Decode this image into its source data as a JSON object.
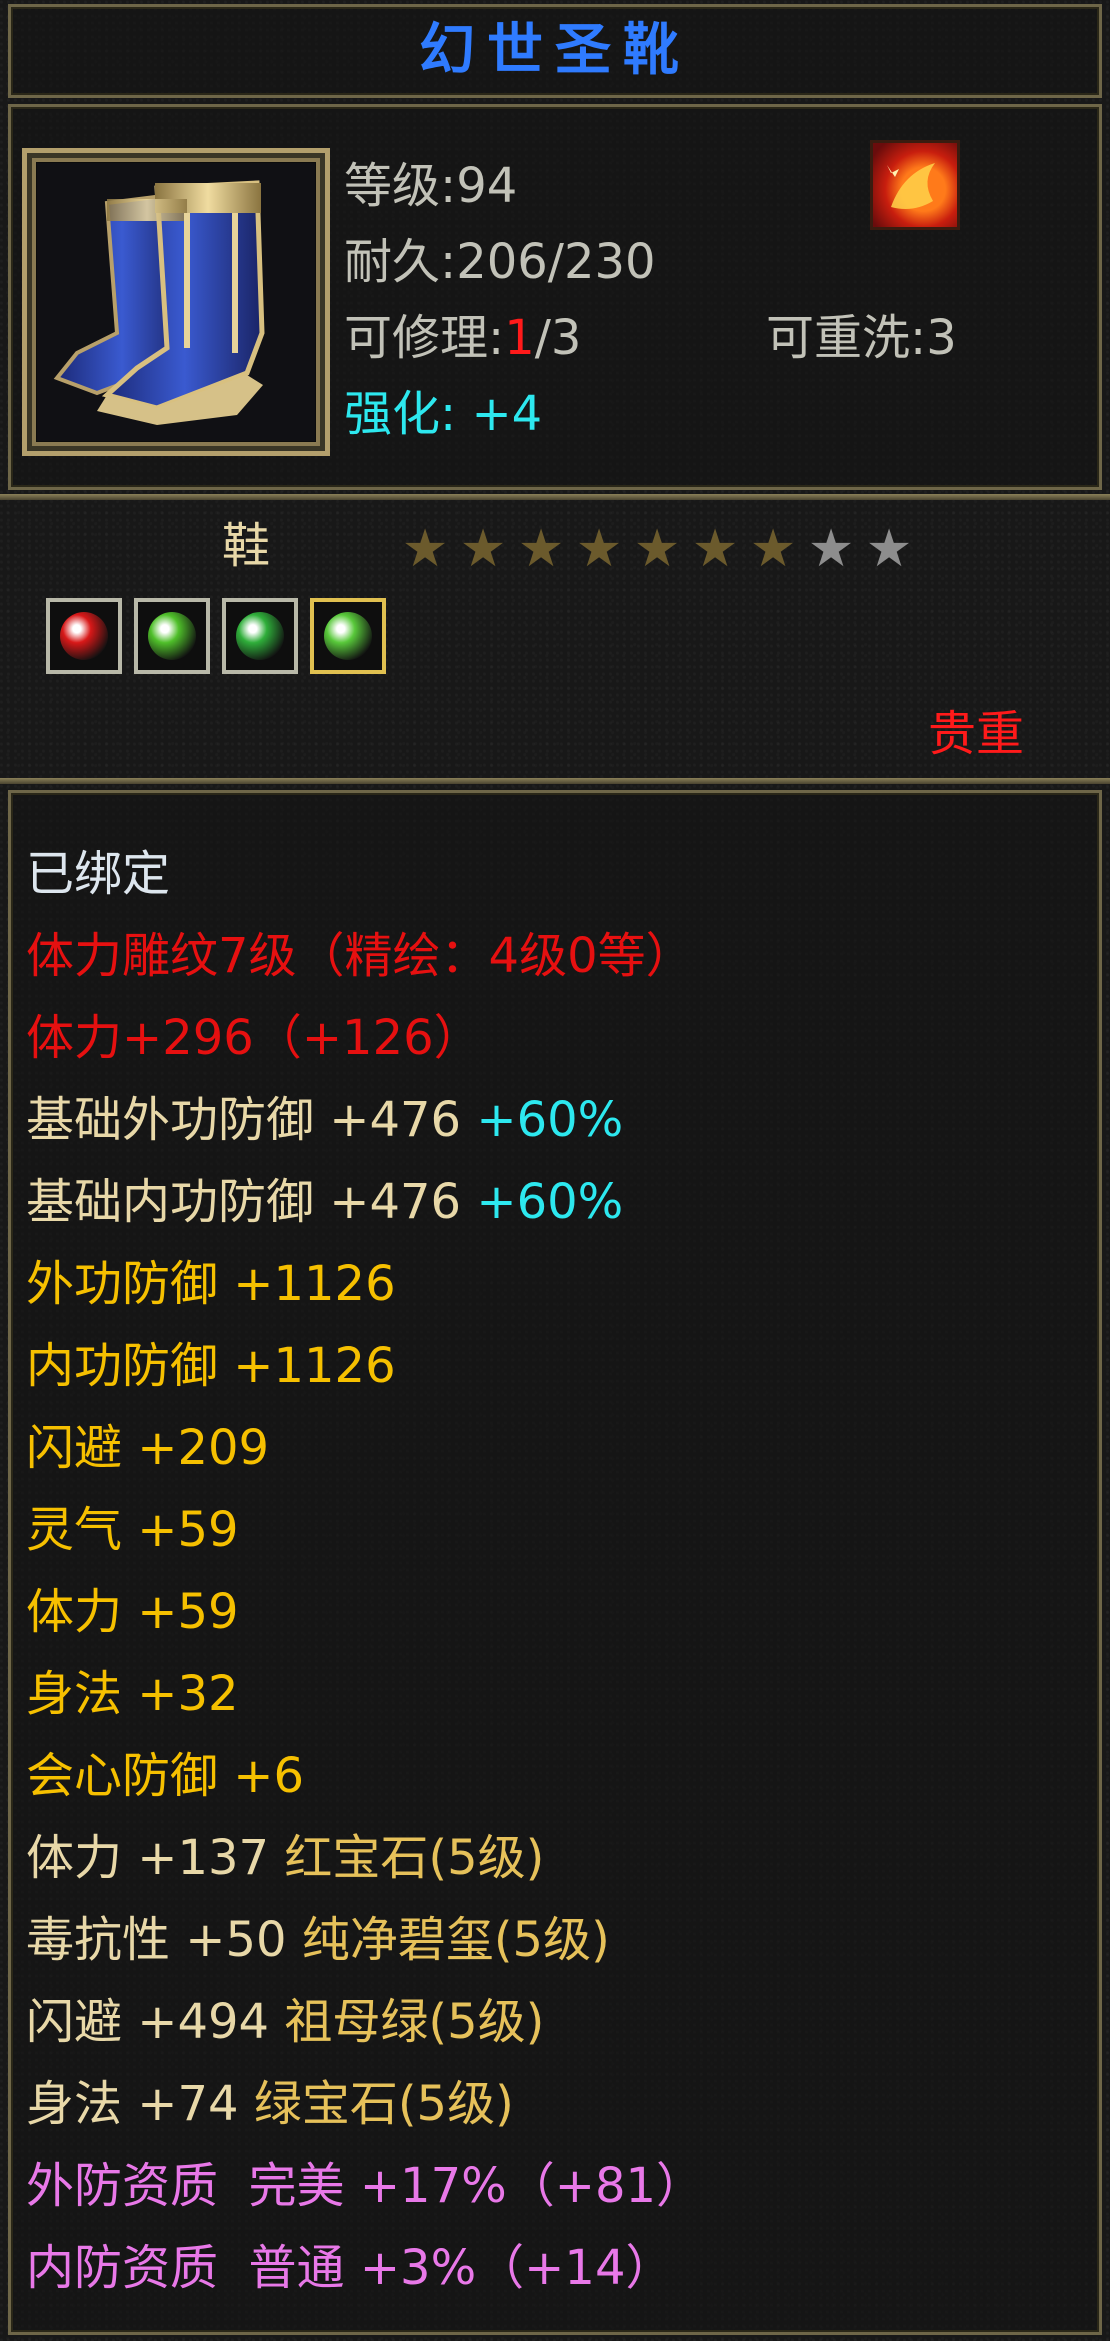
{
  "title": "幻世圣靴",
  "header": {
    "level_label": "等级:",
    "level_value": "94",
    "durability_label": "耐久:",
    "durability_value": "206/230",
    "repair_label": "可修理:",
    "repair_used": "1",
    "repair_total": "/3",
    "rewash_label": "可重洗:",
    "rewash_value": "3",
    "enhance_label": "强化:",
    "enhance_value": "+4",
    "icon": "boots-item-icon",
    "grade_icon": "flame-grade-icon"
  },
  "slot_type": "鞋",
  "stars": {
    "total": 9,
    "filled": 7
  },
  "gems": [
    {
      "name": "红宝石",
      "color": "#d81818"
    },
    {
      "name": "纯净碧玺",
      "color": "#4fbf2a"
    },
    {
      "name": "祖母绿",
      "color": "#2fae3a"
    },
    {
      "name": "绿宝石",
      "color": "#58c83a"
    }
  ],
  "rarity": "贵重",
  "stats": {
    "bound": "已绑定",
    "carving": "体力雕纹7级（精绘：4级0等）",
    "carving_stat": "体力+296（+126）",
    "base_ext_def": {
      "label": "基础外功防御 +476",
      "bonus": "+60%"
    },
    "base_int_def": {
      "label": "基础内功防御 +476",
      "bonus": "+60%"
    },
    "ext_def": "外功防御 +1126",
    "int_def": "内功防御 +1126",
    "dodge": "闪避 +209",
    "spirit": "灵气 +59",
    "stamina": "体力 +59",
    "agility": "身法 +32",
    "crit_def": "会心防御 +6",
    "gem_lines": [
      {
        "stat": "体力 +137",
        "gem": "红宝石(5级)"
      },
      {
        "stat": "毒抗性 +50",
        "gem": "纯净碧玺(5级)"
      },
      {
        "stat": "闪避 +494",
        "gem": "祖母绿(5级)"
      },
      {
        "stat": "身法 +74",
        "gem": "绿宝石(5级)"
      }
    ],
    "quality_ext": {
      "label": "外防资质",
      "grade": "完美",
      "value": "+17%（+81）"
    },
    "quality_int": {
      "label": "内防资质",
      "grade": "普通",
      "value": "+3%（+14）"
    }
  }
}
